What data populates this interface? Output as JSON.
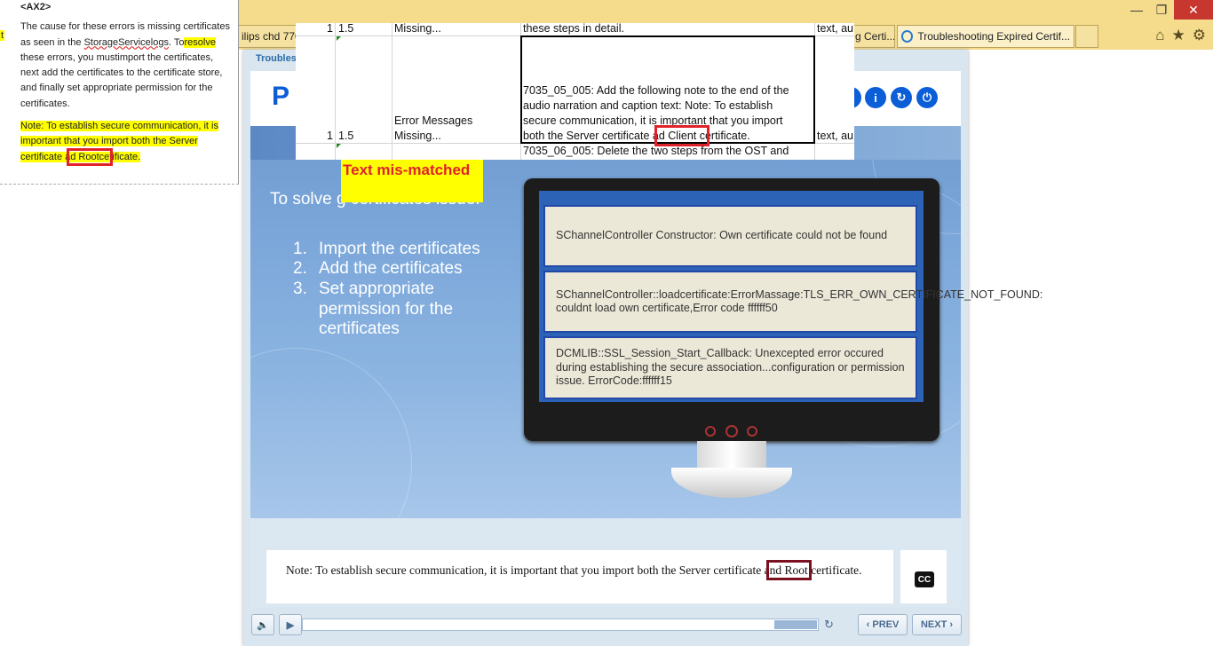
{
  "browser": {
    "tab_left": "ilips chd 770",
    "tab_mid": "g Certi...",
    "tab_active": "Troubleshooting Expired Certif...",
    "win_min": "—",
    "win_restore": "❐",
    "win_close": "✕",
    "icon_home": "⌂",
    "icon_fav": "★",
    "icon_gear": "⚙"
  },
  "word_doc": {
    "heading": "<AX2>",
    "para1_a": "The cause for these errors is missing certificates as seen in the ",
    "para1_link": "StorageServicelogs",
    "para1_b": ". To",
    "para1_hl": "resolve",
    "para1_c": " these errors, you mustimport the certificates, next add the certificates to the certificate store, and finally set appropriate permission for the certificates.",
    "note_a": "Note: To establish secure communication, it is important that you import both the Server certificate a",
    "note_box": "d Rootce",
    "note_b": "tificate.",
    "margin_mark": "t"
  },
  "spreadsheet": {
    "row1_num": "1",
    "row1_ver": "1.5",
    "row1_status": "Missing...",
    "row1_desc": "these steps in detail.",
    "row1_type": "text, au",
    "row2_num": "1",
    "row2_ver": "1.5",
    "row2_status_l1": "Error Messages",
    "row2_status_l2": "Missing...",
    "row2_desc_l1": "7035_05_005: Add the following note to the end of the",
    "row2_desc_l2": "audio narration and caption text: Note: To establish",
    "row2_desc_l3": "secure communication, it is important that you import",
    "row2_desc_l4a": "both the Server certificate a",
    "row2_desc_l4box": "d Client c",
    "row2_desc_l4b": "ertificate.",
    "row2_type": "text, au",
    "row3_desc": "7035_06_005: Delete the two steps from the OST and"
  },
  "annotation_label": "Text mis-matched",
  "course": {
    "title": "Troubles",
    "logo_letter": "P",
    "btn_info": "i",
    "btn_restart": "↻",
    "btn_exit": "⏻",
    "btn_partial": ""
  },
  "slide": {
    "lead": "To solve                   g certificates issue:",
    "steps": [
      {
        "n": "1.",
        "t": "Import the certificates"
      },
      {
        "n": "2.",
        "t": "Add the certificates"
      },
      {
        "n": "3.",
        "t": "Set appropriate permission for the certificates"
      }
    ],
    "errors": [
      "SChannelController Constructor: Own certificate could not be found",
      "SChannelController::loadcertificate:ErrorMassage:TLS_ERR_OWN_CERTIFICATE_NOT_FOUND: couldnt load own certificate,Error code ffffff50",
      "DCMLIB::SSL_Session_Start_Callback: Unexcepted error occured during establishing the secure association...configuration or permission issue. ErrorCode:ffffff15"
    ]
  },
  "caption": {
    "text_a": "Note: To establish secure communication, it is important that you import both the Server certificate a",
    "text_box": "nd Root",
    "text_b": " certificate.",
    "cc_label": "CC"
  },
  "controls": {
    "volume_icon": "🔈",
    "play_icon": "▶",
    "replay_icon": "↻",
    "prev_label": "‹ PREV",
    "next_label": "NEXT ›",
    "progress": 0.92
  }
}
